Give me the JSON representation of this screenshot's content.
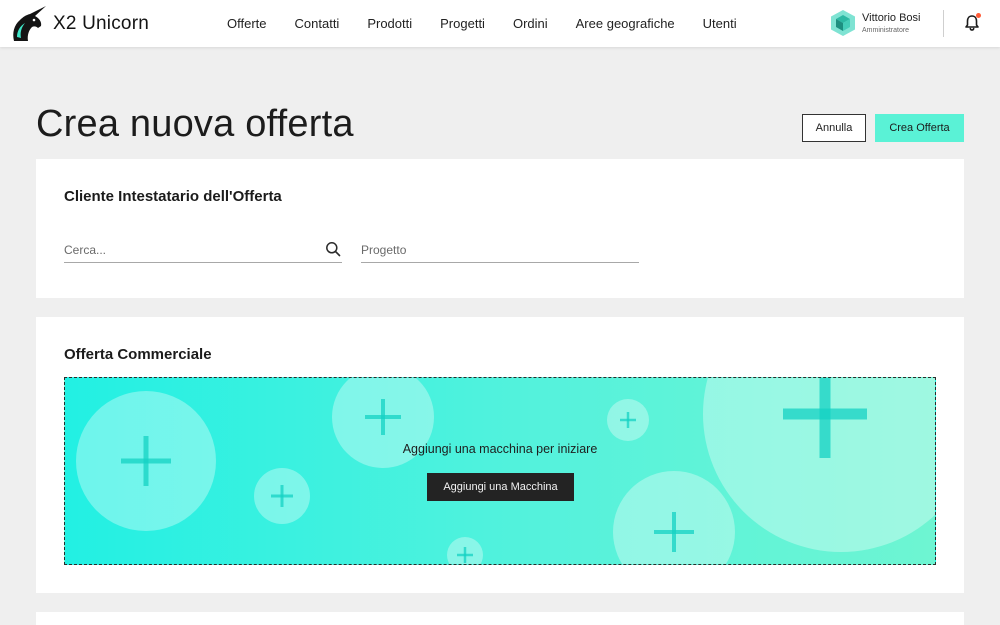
{
  "header": {
    "brand": "X2 Unicorn",
    "nav": [
      "Offerte",
      "Contatti",
      "Prodotti",
      "Progetti",
      "Ordini",
      "Aree geografiche",
      "Utenti"
    ],
    "user": {
      "name": "Vittorio Bosi",
      "role": "Amministratore"
    },
    "icons": {
      "logo": "unicorn-logo-icon",
      "avatar": "cube-avatar-icon",
      "notifications": "bell-icon"
    },
    "notification_dot_color": "#ff5a36"
  },
  "page": {
    "title": "Crea nuova offerta",
    "actions": {
      "cancel_label": "Annulla",
      "create_label": "Crea Offerta"
    }
  },
  "client_section": {
    "title": "Cliente Intestatario dell'Offerta",
    "search": {
      "placeholder": "Cerca...",
      "value": ""
    },
    "project": {
      "placeholder": "Progetto",
      "value": ""
    }
  },
  "offer_section": {
    "title": "Offerta Commerciale",
    "empty_text": "Aggiungi una macchina per iniziare",
    "add_button_label": "Aggiungi una Macchina"
  },
  "colors": {
    "accent": "#5af2d6",
    "gradient_start": "#22f0e3",
    "gradient_end": "#6ef5d2",
    "dark_button": "#232323",
    "background": "#efefef"
  }
}
